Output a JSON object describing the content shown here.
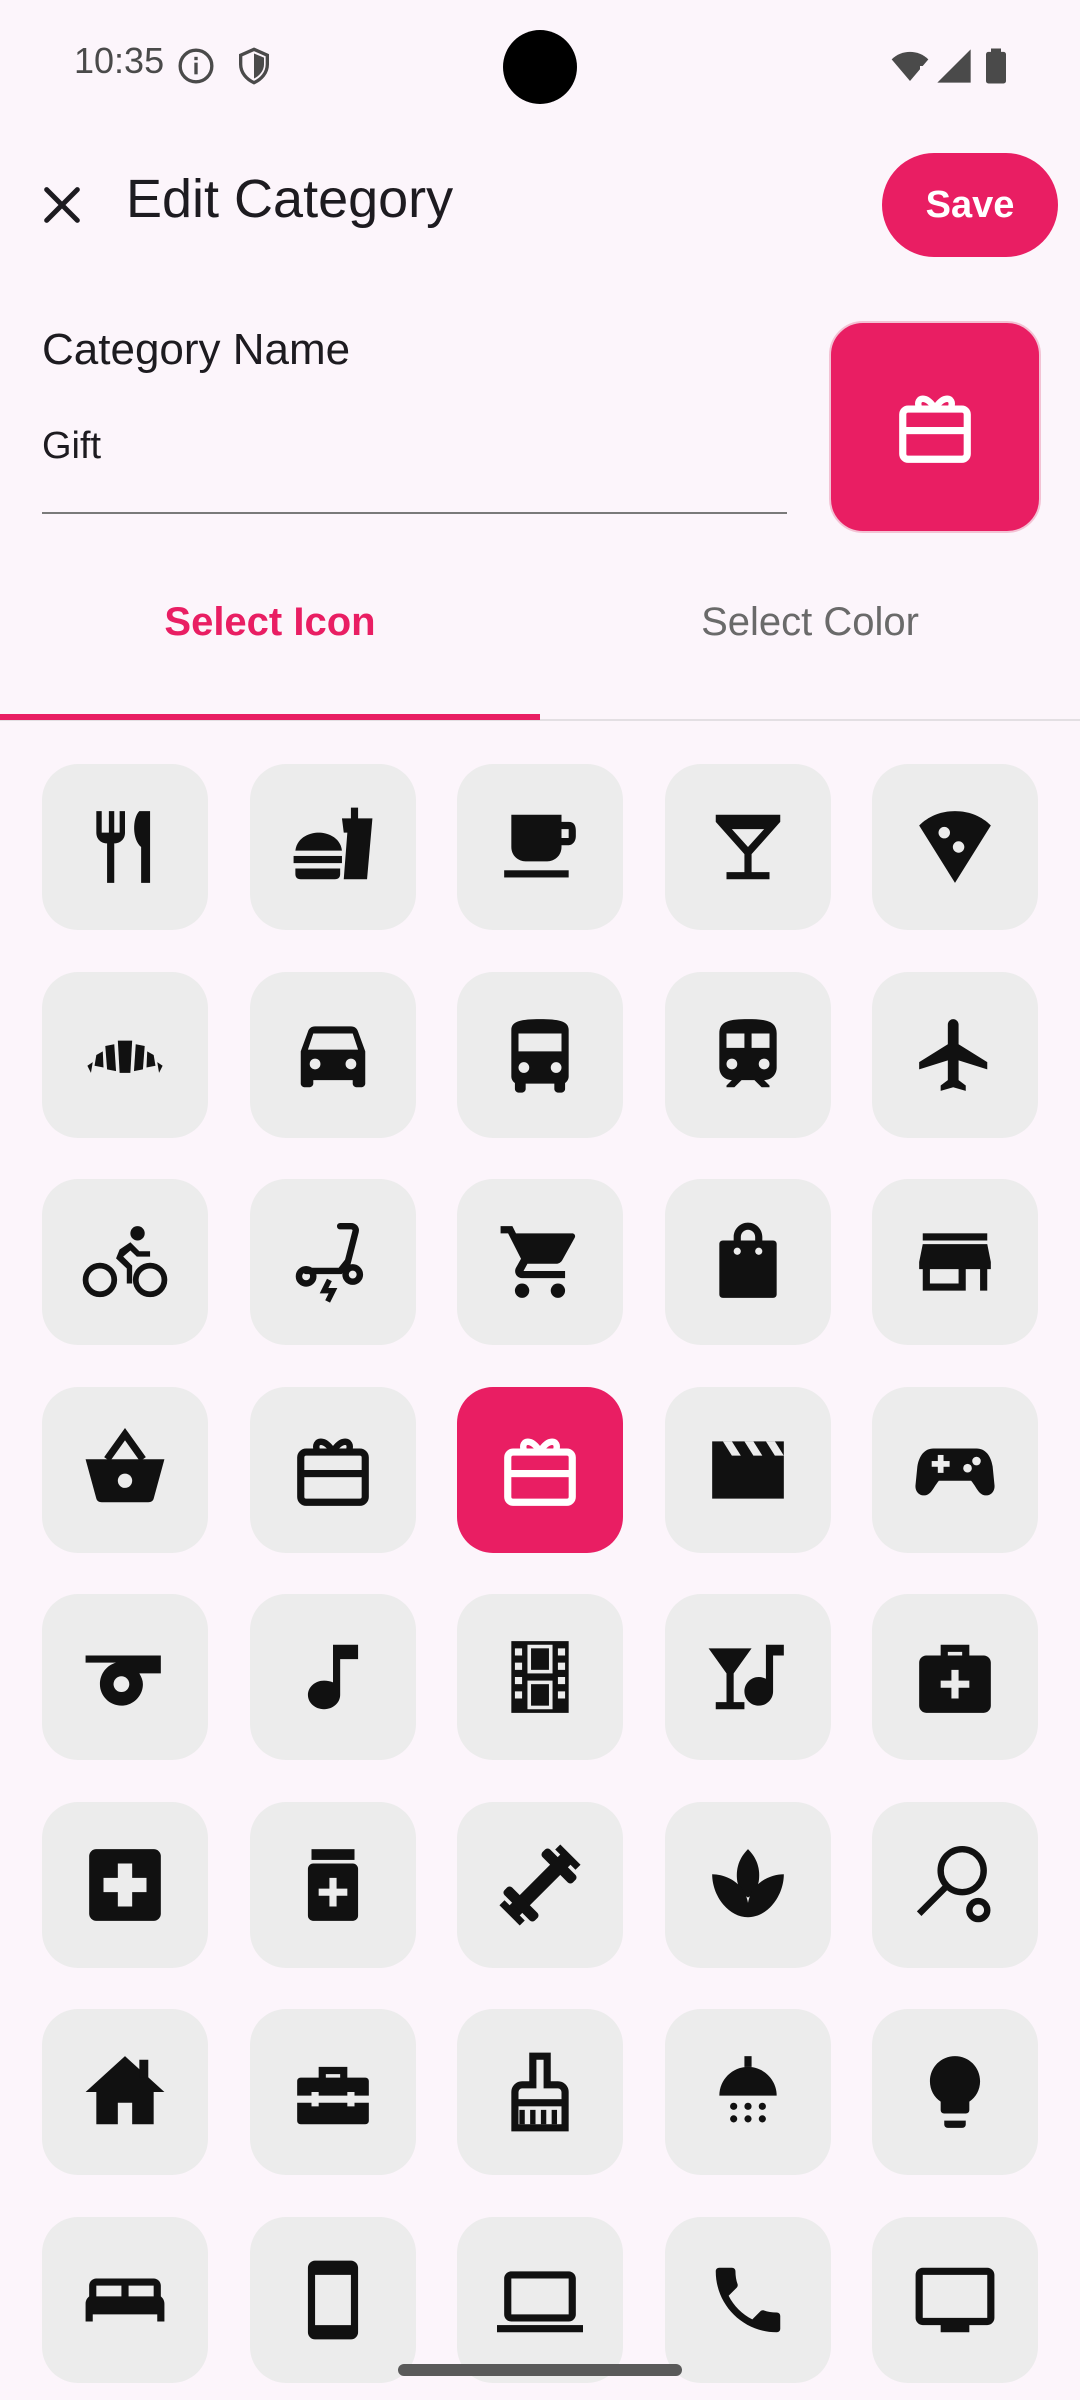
{
  "status": {
    "time": "10:35"
  },
  "header": {
    "title": "Edit Category",
    "save_label": "Save"
  },
  "form": {
    "name_label": "Category Name",
    "name_value": "Gift"
  },
  "tabs": [
    {
      "label": "Select Icon",
      "active": true
    },
    {
      "label": "Select Color",
      "active": false
    }
  ],
  "accent_color": "#e91e63",
  "selected_icon": "gift-card-icon",
  "icons": [
    "restaurant-icon",
    "fastfood-icon",
    "coffee-icon",
    "cocktail-icon",
    "pizza-icon",
    "bakery-icon",
    "car-icon",
    "bus-icon",
    "train-icon",
    "airplane-icon",
    "bicycle-icon",
    "scooter-icon",
    "shopping-cart-icon",
    "shopping-bag-icon",
    "store-icon",
    "basket-icon",
    "gift-box-icon",
    "gift-card-icon",
    "movie-clapper-icon",
    "gamepad-icon",
    "whistle-icon",
    "music-note-icon",
    "film-strip-icon",
    "nightlife-icon",
    "medical-kit-icon",
    "hospital-icon",
    "medication-icon",
    "fitness-icon",
    "spa-icon",
    "sports-tennis-icon",
    "home-icon",
    "toolbox-icon",
    "cleaning-brush-icon",
    "shower-icon",
    "lightbulb-icon",
    "bed-icon",
    "smartphone-icon",
    "laptop-icon",
    "phone-icon",
    "tv-icon"
  ]
}
